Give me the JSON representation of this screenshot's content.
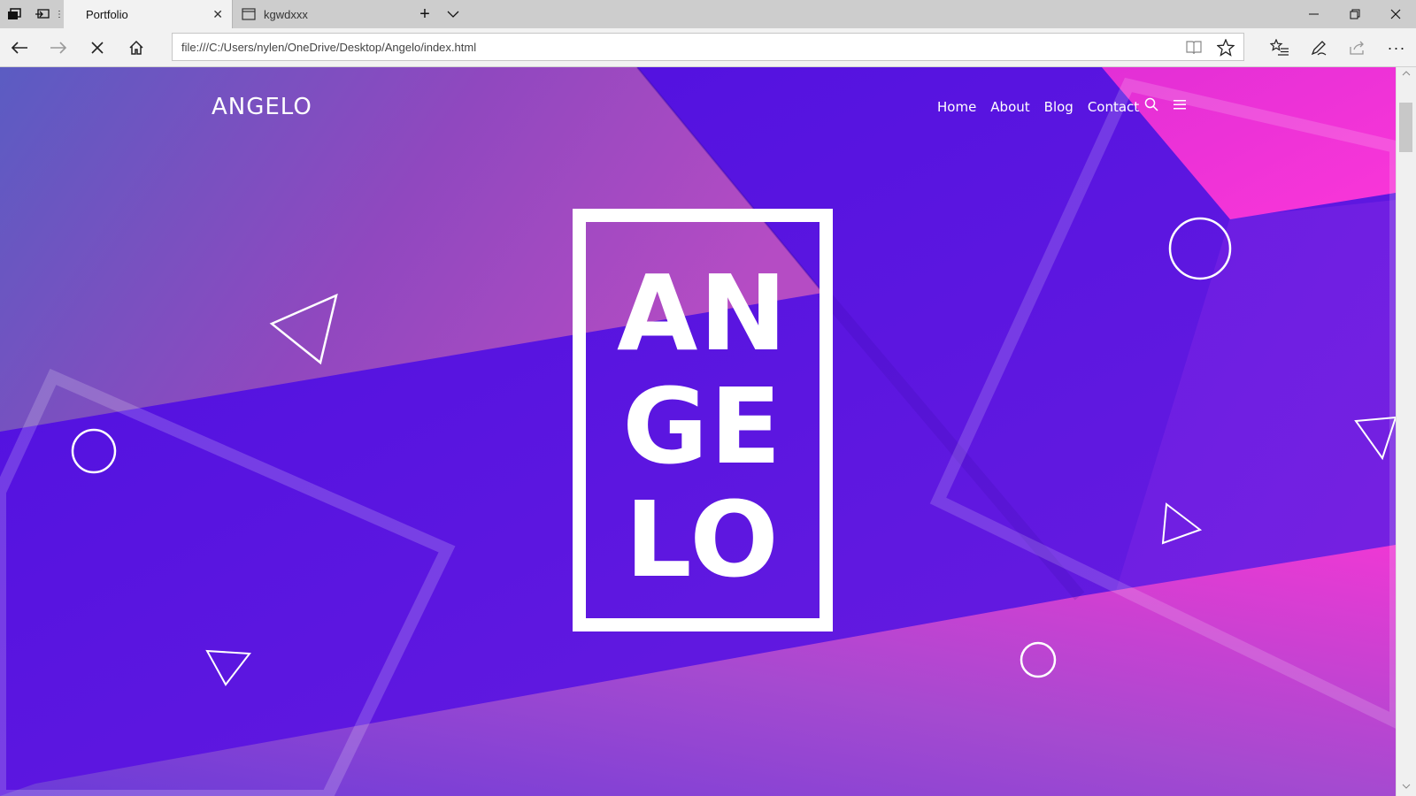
{
  "browser": {
    "tabs": [
      {
        "title": "Portfolio",
        "active": true
      },
      {
        "title": "kgwdxxx",
        "active": false
      }
    ],
    "address": "file:///C:/Users/nylen/OneDrive/Desktop/Angelo/index.html",
    "icons": {
      "set_aside": "set-aside-tabs-icon",
      "tab_preview": "tab-preview-icon",
      "new_tab": "plus-icon",
      "tab_list": "chevron-down-icon",
      "minimize": "minimize-icon",
      "restore": "restore-icon",
      "close": "close-icon",
      "back": "arrow-left-icon",
      "forward": "arrow-right-icon",
      "stop": "stop-icon",
      "home": "home-icon",
      "reading_view": "book-icon",
      "favorite": "star-icon",
      "favorites_hub": "favorites-list-icon",
      "notes": "pen-icon",
      "share": "share-icon",
      "more": "more-icon"
    }
  },
  "site": {
    "logo": "ANGELO",
    "nav": [
      "Home",
      "About",
      "Blog",
      "Contact"
    ],
    "hero_lines": [
      "AN",
      "GE",
      "LO"
    ],
    "colors": {
      "purple": "#5a12e0",
      "magenta": "#e93ad6",
      "violet_top_left": "#5b5cc2"
    }
  }
}
